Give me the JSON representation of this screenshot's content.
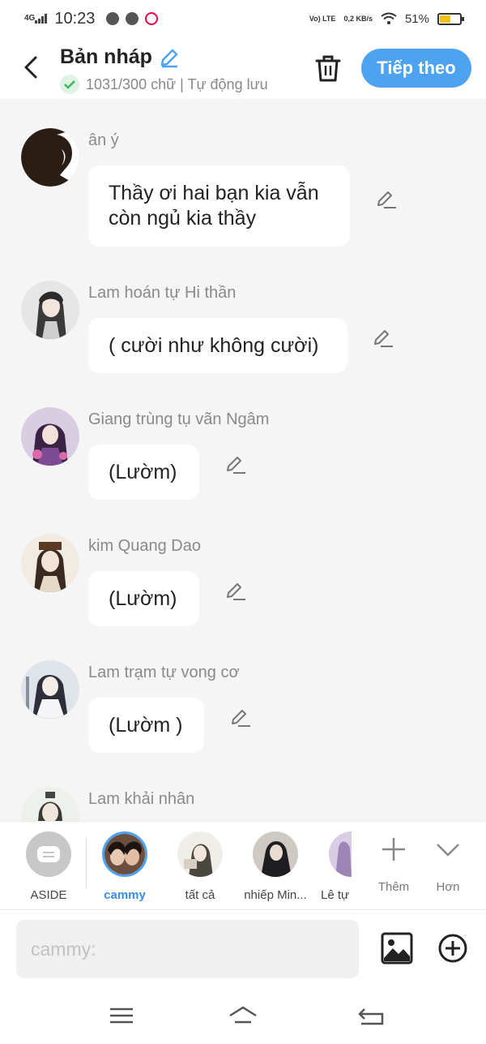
{
  "status": {
    "network": "4G",
    "time": "10:23",
    "volte": "Vo) LTE",
    "speed": "0,2 KB/s",
    "battery": "51%",
    "battery_level": 0.51
  },
  "header": {
    "title": "Bản nháp",
    "subtitle": "1031/300 chữ | Tự động lưu",
    "next_label": "Tiếp theo"
  },
  "messages": [
    {
      "name": "ân ý",
      "text": "Thầy ơi hai bạn kia vẫn còn ngủ kia thầy"
    },
    {
      "name": "Lam hoán tự Hi thần",
      "text": "( cười như không cười)"
    },
    {
      "name": "Giang trùng tụ vãn Ngâm",
      "text": "(Lườm)"
    },
    {
      "name": "kim Quang Dao",
      "text": "(Lườm)"
    },
    {
      "name": "Lam trạm tự vong cơ",
      "text": "(Lườm )"
    },
    {
      "name": "Lam khải nhân",
      "text": ""
    }
  ],
  "characters": [
    {
      "label": "ASIDE"
    },
    {
      "label": "cammy"
    },
    {
      "label": "tất cả"
    },
    {
      "label": "nhiếp Min..."
    },
    {
      "label": "Lê tự"
    }
  ],
  "tools": {
    "more_label": "Thêm",
    "collapse_label": "Hơn"
  },
  "composer": {
    "placeholder": "cammy:"
  },
  "colors": {
    "accent": "#4da3f0",
    "selected_label": "#3b8ee6"
  }
}
